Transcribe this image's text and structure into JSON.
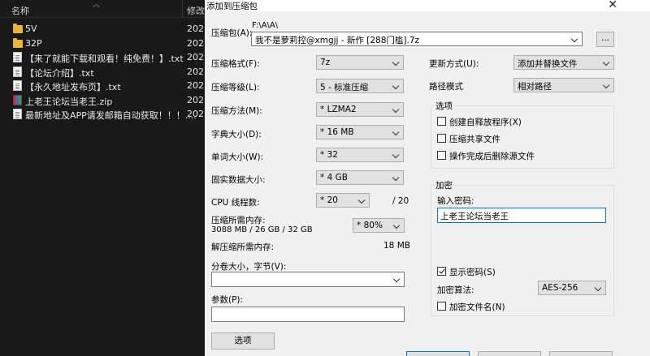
{
  "explorer": {
    "col_name": "名称",
    "col_modified": "修改",
    "files": [
      {
        "name": "5V",
        "type": "folder",
        "modified": "202"
      },
      {
        "name": "32P",
        "type": "folder",
        "modified": "202"
      },
      {
        "name": "【来了就能下载和观看！纯免费！】.txt",
        "type": "txt",
        "modified": "202"
      },
      {
        "name": "【论坛介绍】.txt",
        "type": "txt",
        "modified": "202"
      },
      {
        "name": "【永久地址发布页】.txt",
        "type": "txt",
        "modified": "202"
      },
      {
        "name": "上老王论坛当老王.zip",
        "type": "zip",
        "modified": "202"
      },
      {
        "name": "最新地址及APP请发邮箱自动获取！！！....",
        "type": "txt",
        "modified": "202"
      }
    ]
  },
  "dialog": {
    "title": "添加到压缩包",
    "archive_label": "压缩包(A):",
    "archive_path": "F:\\A\\A\\",
    "archive_name": "我不是萝莉控@xmgjj - 新作 [288门槛].7z",
    "browse_label": "...",
    "format_label": "压缩格式(F):",
    "format_value": "7z",
    "level_label": "压缩等级(L):",
    "level_value": "5 - 标准压缩",
    "method_label": "压缩方法(M):",
    "method_value": "* LZMA2",
    "dict_label": "字典大小(D):",
    "dict_value": "* 16 MB",
    "word_label": "单词大小(W):",
    "word_value": "* 32",
    "solid_label": "固实数据大小:",
    "solid_value": "* 4 GB",
    "cpu_label": "CPU 线程数:",
    "cpu_value": "* 20",
    "cpu_max": "/ 20",
    "mem_label": "压缩所需内存:",
    "mem_detail": "3088 MB / 26 GB / 32 GB",
    "mem_percent": "* 80%",
    "decomp_label": "解压缩所需内存:",
    "decomp_value": "18 MB",
    "split_label": "分卷大小，字节(V):",
    "params_label": "参数(P):",
    "options_button": "选项",
    "update_label": "更新方式(U):",
    "update_value": "添加并替换文件",
    "path_label": "路径模式",
    "path_value": "相对路径",
    "options_group": "选项",
    "opt_sfx": "创建自释放程序(X)",
    "opt_shared": "压缩共享文件",
    "opt_delete": "操作完成后删除源文件",
    "encrypt_group": "加密",
    "password_label": "输入密码:",
    "password_value": "上老王论坛当老王",
    "show_password": "显示密码(S)",
    "enc_method_label": "加密算法:",
    "enc_method_value": "AES-256",
    "enc_filenames": "加密文件名(N)"
  }
}
